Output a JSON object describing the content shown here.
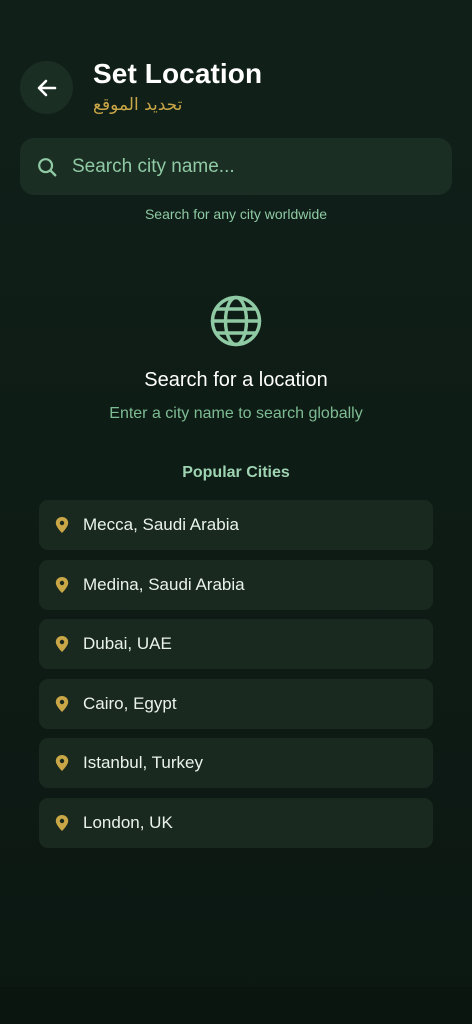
{
  "header": {
    "title": "Set Location",
    "subtitle": "تحديد الموقع"
  },
  "search": {
    "placeholder": "Search city name...",
    "value": "",
    "hint": "Search for any city worldwide"
  },
  "empty_state": {
    "icon": "globe-icon",
    "title": "Search for a location",
    "subtitle": "Enter a city name to search globally"
  },
  "popular": {
    "heading": "Popular Cities",
    "cities": [
      {
        "label": "Mecca, Saudi Arabia",
        "icon": "map-pin-icon"
      },
      {
        "label": "Medina, Saudi Arabia",
        "icon": "map-pin-icon"
      },
      {
        "label": "Dubai, UAE",
        "icon": "map-pin-icon"
      },
      {
        "label": "Cairo, Egypt",
        "icon": "map-pin-icon"
      },
      {
        "label": "Istanbul, Turkey",
        "icon": "map-pin-icon"
      },
      {
        "label": "London, UK",
        "icon": "map-pin-icon"
      }
    ]
  },
  "colors": {
    "background": "#0e1b15",
    "card": "#1b2e24",
    "accent_green": "#8fcaa4",
    "accent_gold": "#c9a646"
  }
}
